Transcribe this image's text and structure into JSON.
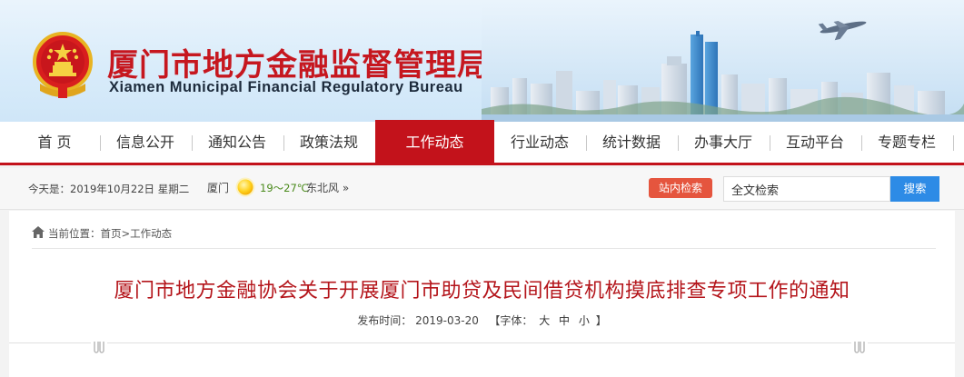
{
  "header": {
    "title_cn": "厦门市地方金融监督管理局",
    "title_en": "Xiamen Municipal Financial Regulatory Bureau"
  },
  "nav": {
    "items": [
      {
        "label": "首 页"
      },
      {
        "label": "信息公开"
      },
      {
        "label": "通知公告"
      },
      {
        "label": "政策法规"
      },
      {
        "label": "工作动态",
        "active": true
      },
      {
        "label": "行业动态"
      },
      {
        "label": "统计数据"
      },
      {
        "label": "办事大厅"
      },
      {
        "label": "互动平台"
      },
      {
        "label": "专题专栏"
      }
    ],
    "accent_color": "#c3121b"
  },
  "infobar": {
    "date": "今天是：2019年10月22日 星期二",
    "city": "厦门",
    "weather_icon": "sun-icon",
    "temperature": "19～27℃",
    "wind": "东北风 »",
    "site_search_label": "站内检索",
    "search_value": "全文检索",
    "search_button": "搜索"
  },
  "breadcrumb": {
    "icon": "home-icon",
    "text": "当前位置：首页>工作动态"
  },
  "article": {
    "title": "厦门市地方金融协会关于开展厦门市助贷及民间借贷机构摸底排查专项工作的通知",
    "date_label": "发布时间：",
    "date": "2019-03-20",
    "font_label": "【字体：",
    "font_large": "大",
    "font_medium": "中",
    "font_small": "小",
    "font_close": "】"
  }
}
